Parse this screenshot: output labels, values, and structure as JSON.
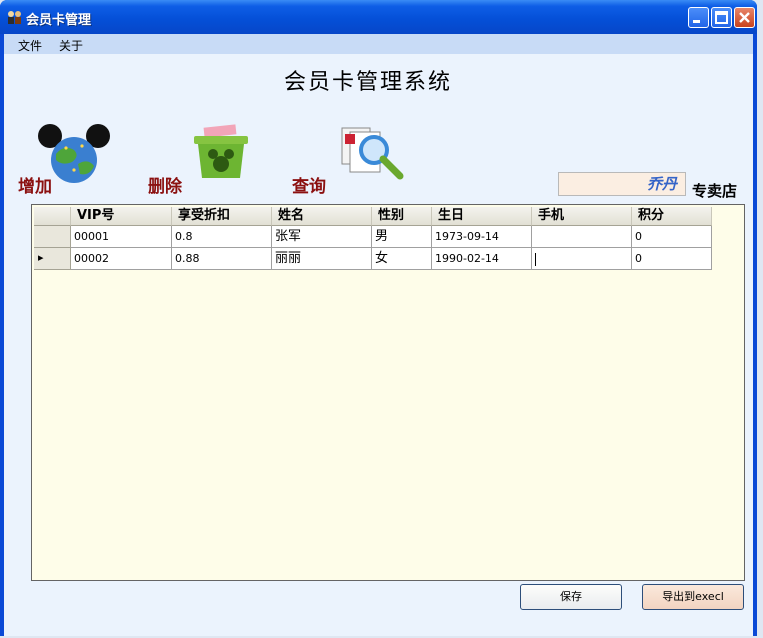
{
  "window": {
    "title": "会员卡管理"
  },
  "menu": [
    "文件",
    "关于"
  ],
  "app_title": "会员卡管理系统",
  "actions": {
    "add": "增加",
    "delete": "删除",
    "query": "查询"
  },
  "store": {
    "name": "乔丹",
    "suffix": "专卖店"
  },
  "grid": {
    "columns": [
      "VIP号",
      "享受折扣",
      "姓名",
      "性别",
      "生日",
      "手机",
      "积分"
    ],
    "rows": [
      {
        "vip": "00001",
        "discount": "0.8",
        "name": "张军",
        "gender": "男",
        "birthday": "1973-09-14",
        "phone": "",
        "points": "0"
      },
      {
        "vip": "00002",
        "discount": "0.88",
        "name": "丽丽",
        "gender": "女",
        "birthday": "1990-02-14",
        "phone": "",
        "points": "0"
      }
    ],
    "current_row_marker": "▸"
  },
  "buttons": {
    "save": "保存",
    "export": "导出到execl"
  }
}
